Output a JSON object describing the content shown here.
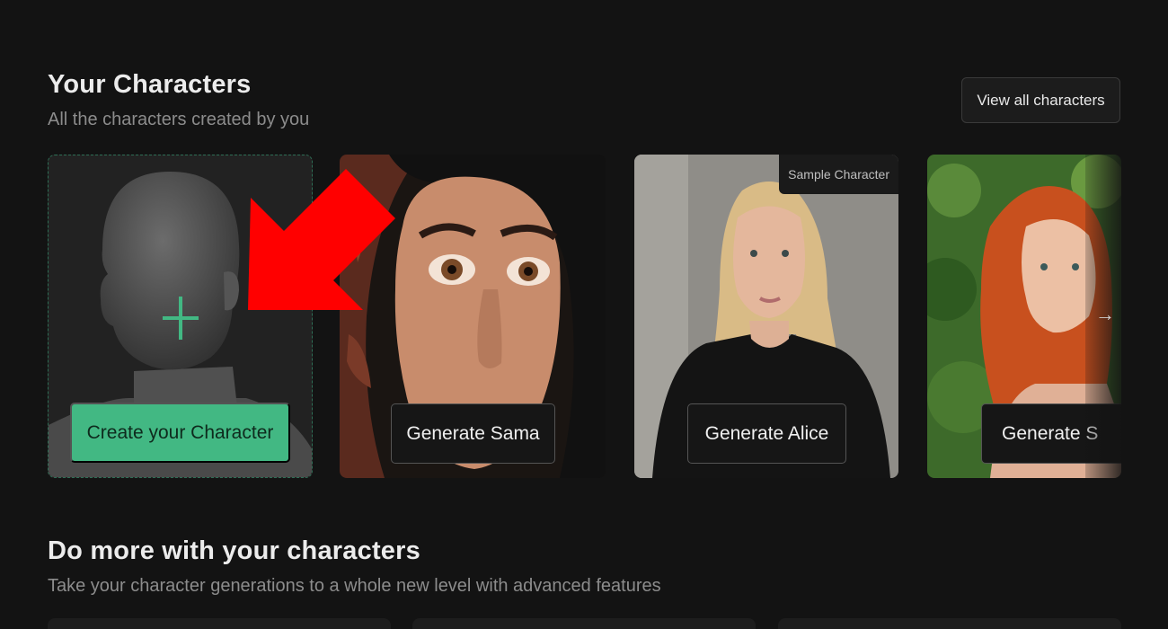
{
  "characters_section": {
    "title": "Your Characters",
    "subtitle": "All the characters created by you",
    "view_all_label": "View all characters",
    "create_label": "Create your Character",
    "cards": [
      {
        "button": "Generate Sama",
        "badge": ""
      },
      {
        "button": "Generate Alice",
        "badge": "Sample Character"
      },
      {
        "button": "Generate S",
        "badge": ""
      }
    ]
  },
  "more_section": {
    "title": "Do more with your characters",
    "subtitle": "Take your character generations to a whole new level with advanced features"
  },
  "colors": {
    "background": "#131313",
    "accent_green": "#42b883",
    "annotation_red": "#ff0000"
  },
  "icons": {
    "create": "plus-icon",
    "carousel_next": "arrow-right-icon",
    "annotation": "red-arrow"
  }
}
